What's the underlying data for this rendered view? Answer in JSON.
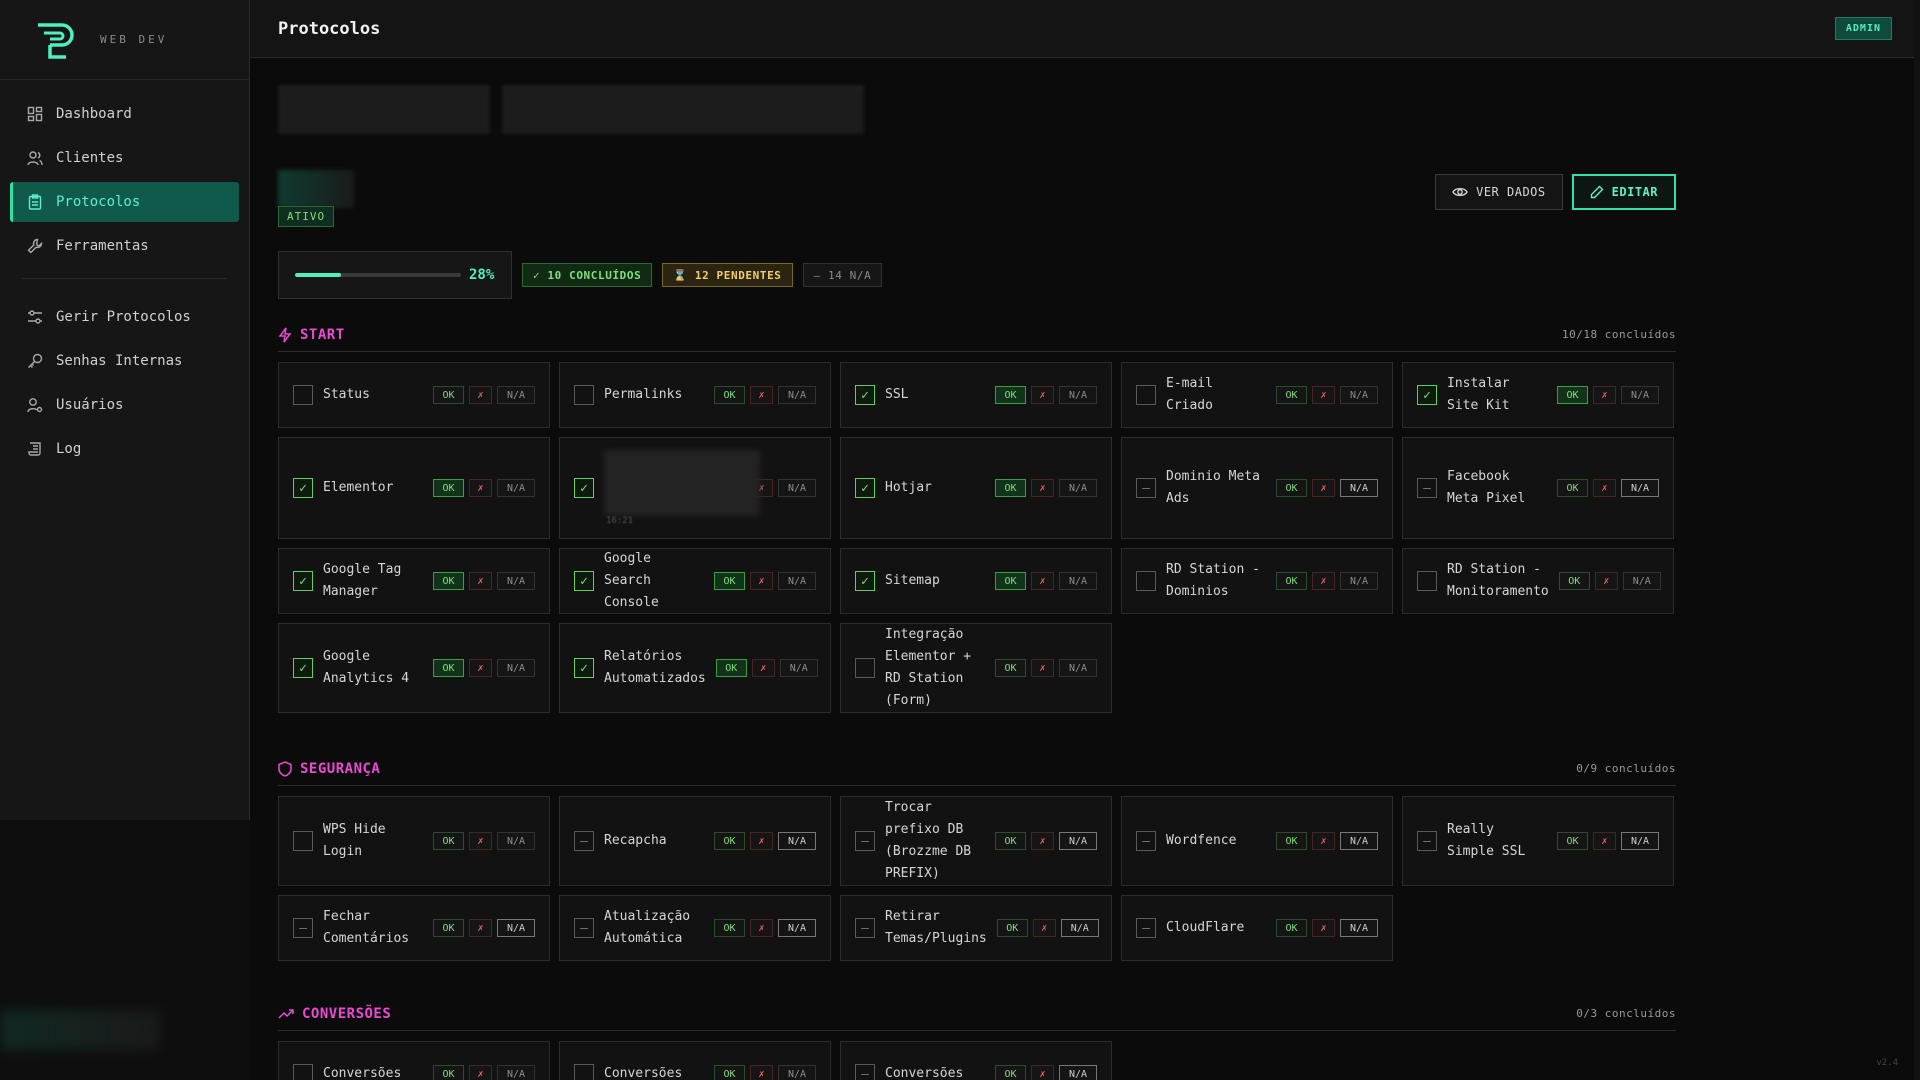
{
  "brand": {
    "text": "WEB DEV"
  },
  "nav": {
    "items": [
      {
        "label": "Dashboard",
        "icon": "grid-icon"
      },
      {
        "label": "Clientes",
        "icon": "users-icon"
      },
      {
        "label": "Protocolos",
        "icon": "clipboard-icon",
        "active": true
      },
      {
        "label": "Ferramentas",
        "icon": "wrench-icon"
      }
    ],
    "admin_items": [
      {
        "label": "Gerir Protocolos",
        "icon": "sliders-icon"
      },
      {
        "label": "Senhas Internas",
        "icon": "key-icon"
      },
      {
        "label": "Usuários",
        "icon": "user-cog-icon"
      },
      {
        "label": "Log",
        "icon": "scroll-icon"
      }
    ]
  },
  "header": {
    "title": "Protocolos",
    "role_badge": "ADMIN"
  },
  "status": {
    "badge": "ATIVO"
  },
  "actions": {
    "view_label": "VER DADOS",
    "edit_label": "EDITAR"
  },
  "progress": {
    "percent_label": "28%",
    "fraction": 0.28,
    "done_label": "✓ 10 CONCLUÍDOS",
    "pending_label": "⌛ 12 PENDENTES",
    "na_label": "— 14 N/A"
  },
  "options": {
    "ok": "OK",
    "x": "✗",
    "na": "N/A"
  },
  "sections": {
    "start": {
      "title": "START",
      "count": "10/18 concluídos",
      "items": [
        {
          "label": "Status",
          "state": "empty"
        },
        {
          "label": "Permalinks",
          "state": "empty"
        },
        {
          "label": "SSL",
          "state": "checked"
        },
        {
          "label": "E-mail Criado",
          "state": "empty"
        },
        {
          "label": "Instalar Site Kit",
          "state": "checked"
        },
        {
          "label": "Elementor",
          "state": "checked"
        },
        {
          "label": "",
          "state": "checked"
        },
        {
          "label": "Hotjar",
          "state": "checked"
        },
        {
          "label": "Dominio Meta Ads",
          "state": "na"
        },
        {
          "label": "Facebook Meta Pixel",
          "state": "na"
        },
        {
          "label": "Google Tag Manager",
          "state": "checked"
        },
        {
          "label": "Google Search Console",
          "state": "checked"
        },
        {
          "label": "Sitemap",
          "state": "checked"
        },
        {
          "label": "RD Station - Dominios",
          "state": "empty"
        },
        {
          "label": "RD Station - Monitoramento",
          "state": "empty"
        },
        {
          "label": "Google Analytics 4",
          "state": "checked"
        },
        {
          "label": "Relatórios Automatizados",
          "state": "checked"
        },
        {
          "label": "Integração Elementor + RD Station (Form)",
          "state": "empty"
        }
      ],
      "blurred_time": "16:21"
    },
    "seguranca": {
      "title": "SEGURANÇA",
      "count": "0/9 concluídos",
      "items": [
        {
          "label": "WPS Hide Login",
          "state": "empty"
        },
        {
          "label": "Recapcha",
          "state": "na"
        },
        {
          "label": "Trocar prefixo DB (Brozzme DB PREFIX)",
          "state": "na"
        },
        {
          "label": "Wordfence",
          "state": "na"
        },
        {
          "label": "Really Simple SSL",
          "state": "na"
        },
        {
          "label": "Fechar Comentários",
          "state": "na"
        },
        {
          "label": "Atualização Automática",
          "state": "na"
        },
        {
          "label": "Retirar Temas/Plugins",
          "state": "na"
        },
        {
          "label": "CloudFlare",
          "state": "na"
        }
      ]
    },
    "conversoes": {
      "title": "CONVERSÕES",
      "count": "0/3 concluídos",
      "items": [
        {
          "label": "Conversões",
          "state": "empty"
        },
        {
          "label": "Conversões",
          "state": "empty"
        },
        {
          "label": "Conversões",
          "state": "na"
        }
      ]
    }
  },
  "footer": {
    "version": "v2.4"
  },
  "colors": {
    "accent": "#2de3a8",
    "section_title": "#e94bd3",
    "ok": "#7fe07a",
    "error": "#ff5b5b",
    "pending": "#f0cf6a"
  }
}
